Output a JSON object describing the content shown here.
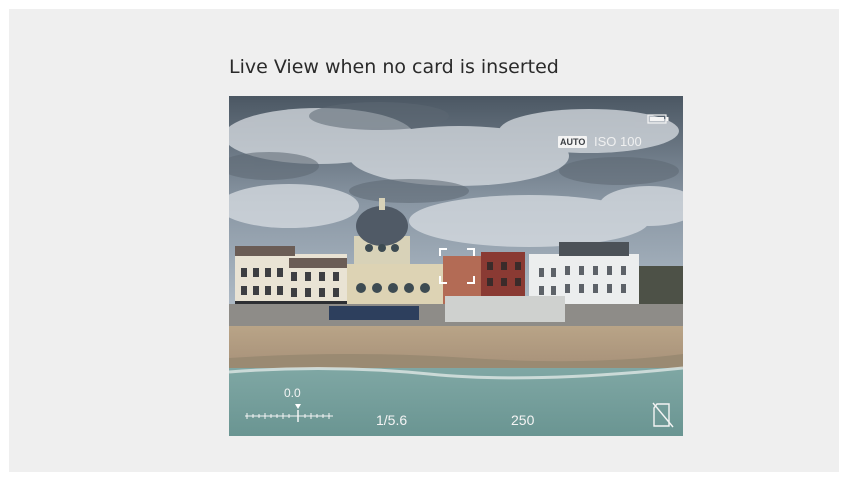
{
  "caption": "Live View when no card is inserted",
  "osd": {
    "auto_badge": "AUTO",
    "iso": "ISO 100",
    "exposure_comp": "0.0",
    "shutter": "1/5.6",
    "aperture": "250"
  },
  "icons": {
    "battery": "battery-icon",
    "no_card": "no-card-icon",
    "af_frame": "af-frame-icon",
    "exposure_scale": "exposure-scale-icon"
  },
  "colors": {
    "panel_bg": "#efefef",
    "osd_text": "#f4f4f4"
  }
}
